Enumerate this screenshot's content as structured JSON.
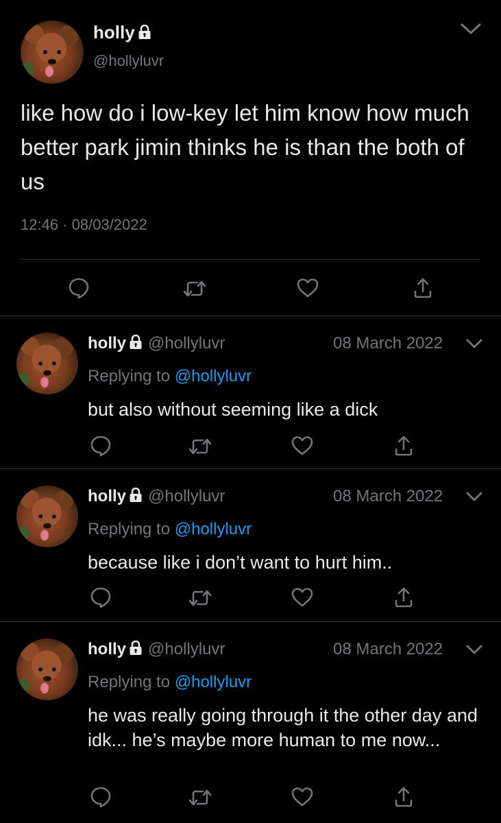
{
  "main_tweet": {
    "name": "holly",
    "handle": "@hollyluvr",
    "text": "like how do i low-key let him know how much better park jimin thinks he is than the both of us",
    "time": "12:46",
    "separator": "·",
    "date": "08/03/2022",
    "icons": [
      "lock-icon",
      "chevron-down-icon",
      "reply-icon",
      "retweet-icon",
      "like-icon",
      "share-icon"
    ]
  },
  "replies": [
    {
      "name": "holly",
      "handle": "@hollyluvr",
      "date": "08 March 2022",
      "replying_prefix": "Replying to",
      "replying_to": "@hollyluvr",
      "text": "but also without seeming like a dick"
    },
    {
      "name": "holly",
      "handle": "@hollyluvr",
      "date": "08 March 2022",
      "replying_prefix": "Replying to",
      "replying_to": "@hollyluvr",
      "text": "because like i don’t want to hurt him.."
    },
    {
      "name": "holly",
      "handle": "@hollyluvr",
      "date": "08 March 2022",
      "replying_prefix": "Replying to",
      "replying_to": "@hollyluvr",
      "text": "he was really going through it the other day and idk... he’s maybe more human to me now..."
    }
  ],
  "colors": {
    "background": "#000000",
    "text": "#e7e9ea",
    "secondary": "#71767b",
    "link": "#1d9bf0",
    "divider": "#2f3336"
  }
}
